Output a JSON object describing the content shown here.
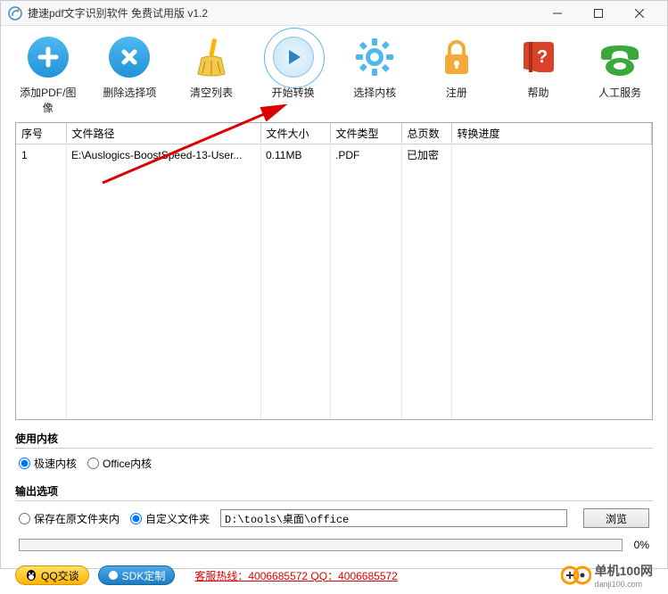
{
  "window": {
    "title": "捷速pdf文字识别软件 免费试用版  v1.2"
  },
  "toolbar": {
    "add": "添加PDF/图像",
    "delete": "删除选择项",
    "clear": "清空列表",
    "convert": "开始转换",
    "kernel": "选择内核",
    "register": "注册",
    "help": "帮助",
    "service": "人工服务"
  },
  "table": {
    "headers": {
      "no": "序号",
      "path": "文件路径",
      "size": "文件大小",
      "type": "文件类型",
      "pages": "总页数",
      "progress": "转换进度"
    },
    "rows": [
      {
        "no": "1",
        "path": "E:\\Auslogics-BoostSpeed-13-User...",
        "size": "0.11MB",
        "type": ".PDF",
        "pages": "已加密",
        "progress": ""
      }
    ]
  },
  "kernel_section": {
    "title": "使用内核",
    "opt1": "极速内核",
    "opt2": "Office内核"
  },
  "output_section": {
    "title": "输出选项",
    "opt1": "保存在原文件夹内",
    "opt2": "自定义文件夹",
    "path": "D:\\tools\\桌面\\office",
    "browse": "浏览"
  },
  "progress": {
    "pct": "0%"
  },
  "footer": {
    "qq": "QQ交谈",
    "sdk": "SDK定制",
    "hotline": "客服热线：4006685572 QQ：4006685572",
    "brand": "单机100网",
    "brand_sub": "danji100.com"
  }
}
